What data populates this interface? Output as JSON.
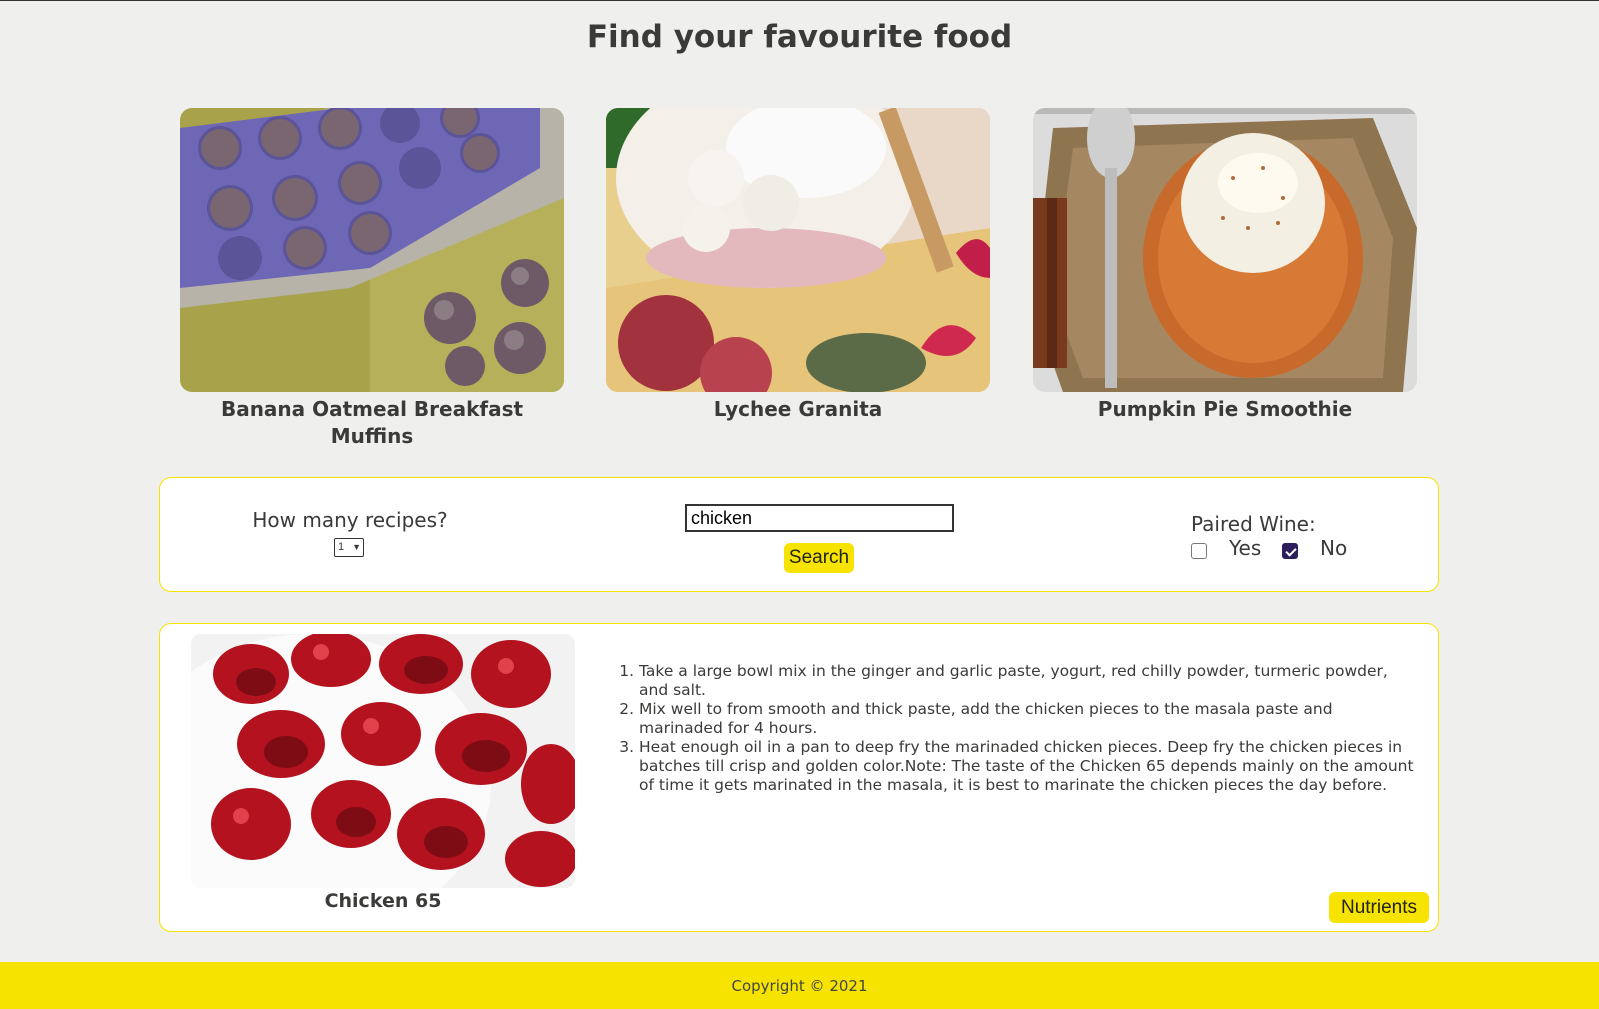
{
  "header": {
    "title": "Find your favourite food"
  },
  "featured": [
    {
      "title": "Banana Oatmeal Breakfast Muffins",
      "image": "muffins-photo"
    },
    {
      "title": "Lychee Granita",
      "image": "lychee-granita-photo"
    },
    {
      "title": "Pumpkin Pie Smoothie",
      "image": "pumpkin-smoothie-photo"
    }
  ],
  "search": {
    "count_label": "How many recipes?",
    "count_value": "1",
    "query": "chicken",
    "button_label": "Search",
    "wine_label": "Paired Wine:",
    "wine_yes": "Yes",
    "wine_no": "No",
    "wine_yes_checked": false,
    "wine_no_checked": true
  },
  "result": {
    "title": "Chicken 65",
    "image": "chicken-65-photo",
    "steps": [
      "Take a large bowl mix in the ginger and garlic paste, yogurt, red chilly powder, turmeric powder, and salt.",
      "Mix well to from smooth and thick paste, add the chicken pieces to the masala paste and marinaded for 4 hours.",
      "Heat enough oil in a pan to deep fry the marinaded chicken pieces. Deep fry the chicken pieces in batches till crisp and golden color.Note: The taste of the Chicken 65 depends mainly on the amount of time it gets marinated in the masala, it is best to marinate the chicken pieces the day before."
    ],
    "nutrients_label": "Nutrients"
  },
  "footer": {
    "text": "Copyright © 2021"
  },
  "colors": {
    "accent": "#f6e400",
    "background": "#efefed",
    "text": "#3a3a38"
  }
}
